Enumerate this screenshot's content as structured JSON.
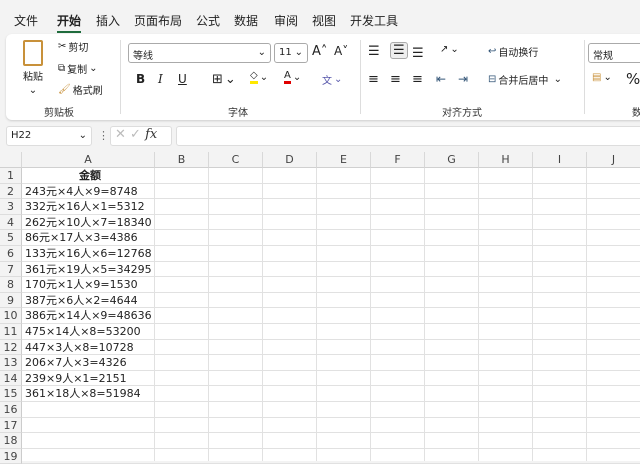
{
  "tabs": [
    "文件",
    "开始",
    "插入",
    "页面布局",
    "公式",
    "数据",
    "审阅",
    "视图",
    "开发工具"
  ],
  "active_tab": "开始",
  "clipboard": {
    "paste": "粘贴",
    "cut": "剪切",
    "copy": "复制",
    "format_painter": "格式刷",
    "label": "剪贴板"
  },
  "font": {
    "name": "等线",
    "size": "11",
    "bold": "B",
    "italic": "I",
    "underline": "U",
    "label": "字体",
    "fill_color": "#ffe800",
    "font_color": "#e00000"
  },
  "alignment": {
    "wrap": "自动换行",
    "merge": "合并后居中",
    "label": "对齐方式"
  },
  "number": {
    "format": "常规",
    "percent": "%",
    "label": "数"
  },
  "formula_bar": {
    "name_box": "H22",
    "fx": "fx",
    "value": ""
  },
  "columns": [
    "A",
    "B",
    "C",
    "D",
    "E",
    "F",
    "G",
    "H",
    "I",
    "J"
  ],
  "rows": [
    "1",
    "2",
    "3",
    "4",
    "5",
    "6",
    "7",
    "8",
    "9",
    "10",
    "11",
    "12",
    "13",
    "14",
    "15",
    "16",
    "17",
    "18",
    "19"
  ],
  "cells_A": [
    "金额",
    "243元×4人×9=8748",
    "332元×16人×1=5312",
    "262元×10人×7=18340",
    "86元×17人×3=4386",
    "133元×16人×6=12768",
    "361元×19人×5=34295",
    "170元×1人×9=1530",
    "387元×6人×2=4644",
    "386元×14人×9=48636",
    "475×14人×8=53200",
    "447×3人×8=10728",
    "206×7人×3=4326",
    "239×9人×1=2151",
    "361×18人×8=51984"
  ]
}
